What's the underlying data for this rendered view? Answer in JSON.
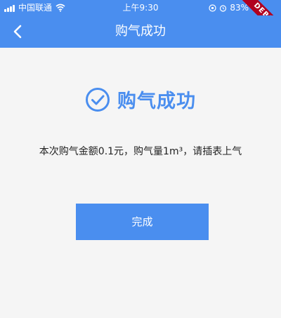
{
  "status_bar": {
    "carrier": "中国联通",
    "time": "上午9:30",
    "battery": "83%"
  },
  "debug_banner": "DEBUG",
  "app_bar": {
    "title": "购气成功",
    "back_icon": "chevron-left-icon"
  },
  "result": {
    "title": "购气成功",
    "icon": "check-circle-icon",
    "detail": "本次购气金额0.1元，购气量1m³，请插表上气"
  },
  "actions": {
    "done_label": "完成"
  },
  "colors": {
    "primary": "#4a8eef",
    "background": "#f5f5f5",
    "debug": "#b00020"
  }
}
